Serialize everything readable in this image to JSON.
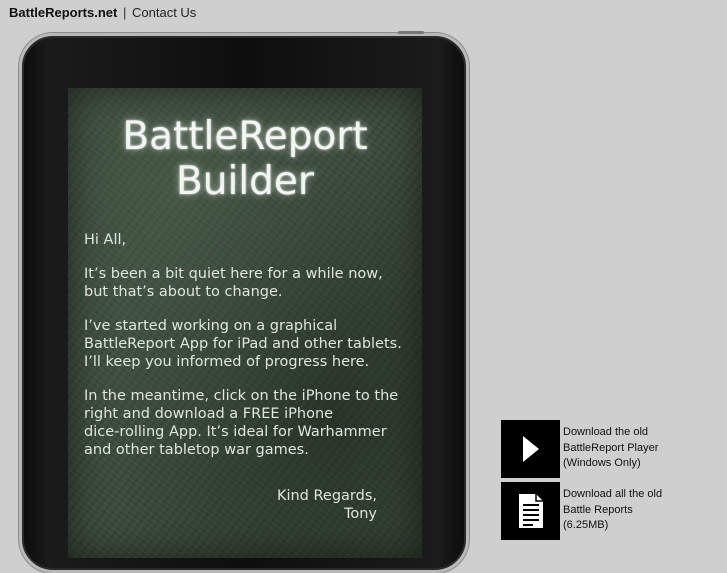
{
  "nav": {
    "brand": "BattleReports.net",
    "separator": "|",
    "contact": "Contact Us"
  },
  "screen": {
    "title_line1": "BattleReport",
    "title_line2": "Builder",
    "paragraphs": [
      "Hi All,",
      "It’s been a bit quiet here for a while now,\nbut that’s about to change.",
      "I’ve started working on a graphical\nBattleReport App for iPad and other tablets.\nI’ll keep you informed of progress here.",
      "In the meantime, click on the iPhone to the\nright and download a FREE iPhone\ndice-rolling App. It’s ideal for Warhammer\nand other tabletop war games."
    ],
    "signoff": "Kind Regards,\nTony"
  },
  "downloads": [
    {
      "icon": "play-icon",
      "text": "Download the old\nBattleReport Player\n(Windows Only)"
    },
    {
      "icon": "document-icon",
      "text": "Download all the old\nBattle Reports\n(6.25MB)"
    }
  ]
}
